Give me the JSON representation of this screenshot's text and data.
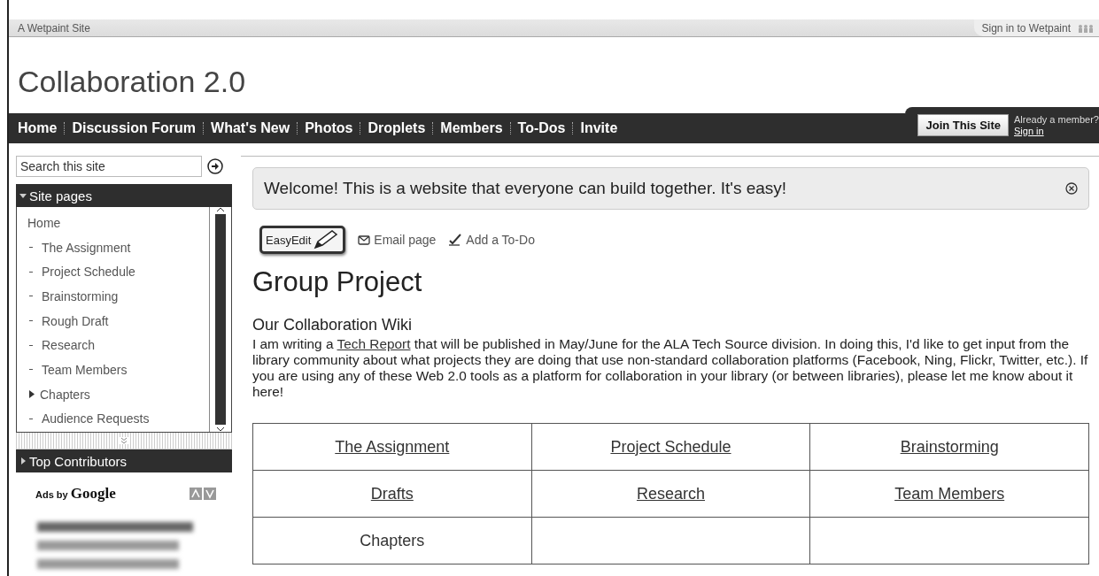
{
  "top_bar": {
    "site_label": "A Wetpaint Site",
    "sign_in": "Sign in to Wetpaint"
  },
  "site_title": "Collaboration 2.0",
  "nav": {
    "items": [
      {
        "label": "Home"
      },
      {
        "label": "Discussion Forum"
      },
      {
        "label": "What's New"
      },
      {
        "label": "Photos"
      },
      {
        "label": "Droplets"
      },
      {
        "label": "Members"
      },
      {
        "label": "To-Dos"
      },
      {
        "label": "Invite"
      }
    ],
    "join_button": "Join This Site",
    "member_prompt": "Already a member?",
    "sign_in_link": "Sign in"
  },
  "sidebar": {
    "search": {
      "placeholder": "Search this site"
    },
    "site_pages": {
      "title": "Site pages",
      "expanded": true,
      "items": [
        {
          "label": "Home",
          "kind": "root"
        },
        {
          "label": "The Assignment",
          "kind": "page"
        },
        {
          "label": "Project Schedule",
          "kind": "page"
        },
        {
          "label": "Brainstorming",
          "kind": "page"
        },
        {
          "label": "Rough Draft",
          "kind": "page"
        },
        {
          "label": "Research",
          "kind": "page"
        },
        {
          "label": "Team Members",
          "kind": "page"
        },
        {
          "label": "Chapters",
          "kind": "folder"
        },
        {
          "label": "Audience Requests",
          "kind": "page"
        }
      ]
    },
    "top_contributors": {
      "title": "Top Contributors",
      "expanded": false
    },
    "ads_label": "Ads by",
    "ads_brand": "Google"
  },
  "content": {
    "welcome": "Welcome! This is a website that everyone can build together. It's easy!",
    "easyedit_button": "EasyEdit",
    "actions": [
      "Email page",
      "Add a To-Do"
    ],
    "page_title": "Group Project",
    "subtitle": "Our Collaboration Wiki",
    "paragraph": {
      "before": "I am writing a ",
      "link": "Tech Report",
      "after": " that will be published in May/June for the ALA Tech Source division. In doing this, I'd like to get input from the library community about what projects they are doing that use non-standard collaboration platforms (Facebook, Ning, Flickr, Twitter, etc.). If you are using any of these Web 2.0 tools as a platform for collaboration in your library (or between libraries), please let me know about it here!"
    },
    "table": {
      "rows": [
        {
          "cells": [
            {
              "text": "The Assignment",
              "kind": "link"
            },
            {
              "text": "Project Schedule",
              "kind": "link"
            },
            {
              "text": "Brainstorming",
              "kind": "link"
            }
          ]
        },
        {
          "cells": [
            {
              "text": "Drafts",
              "kind": "link"
            },
            {
              "text": "Research",
              "kind": "link"
            },
            {
              "text": "Team Members",
              "kind": "link"
            }
          ]
        },
        {
          "cells": [
            {
              "text": "Chapters",
              "kind": "plain"
            }
          ]
        }
      ]
    }
  }
}
